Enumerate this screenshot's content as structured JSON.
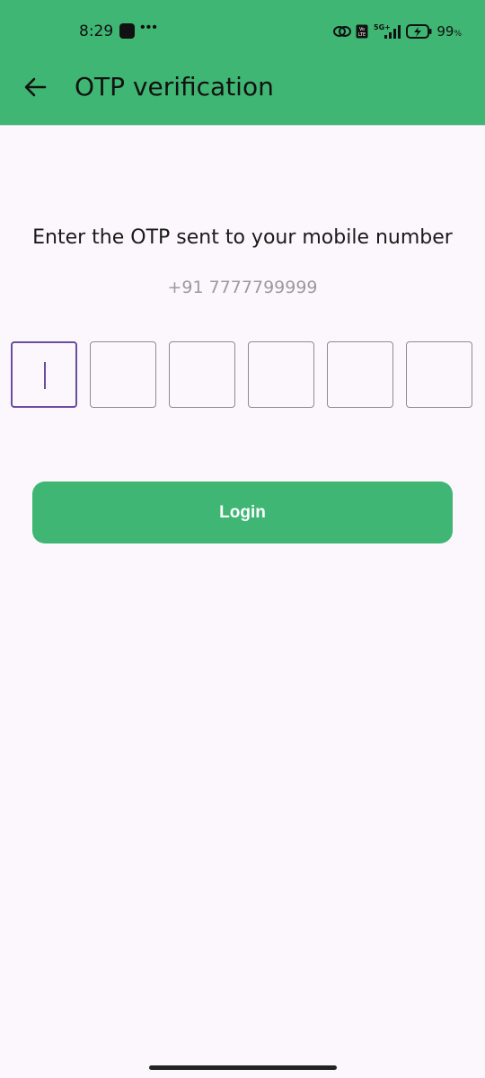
{
  "status_bar": {
    "time": "8:29",
    "battery": "99",
    "battery_unit": "%",
    "network": "5G+"
  },
  "app_bar": {
    "title": "OTP verification",
    "back_icon": "arrow-left-icon",
    "color": "#3fb673"
  },
  "main": {
    "prompt": "Enter the OTP sent to your mobile number",
    "phone": "+91 7777799999",
    "otp_length": 6,
    "otp_active_index": 0,
    "accent_color": "#6a4da3"
  },
  "actions": {
    "login_label": "Login",
    "login_color": "#3fb673"
  }
}
